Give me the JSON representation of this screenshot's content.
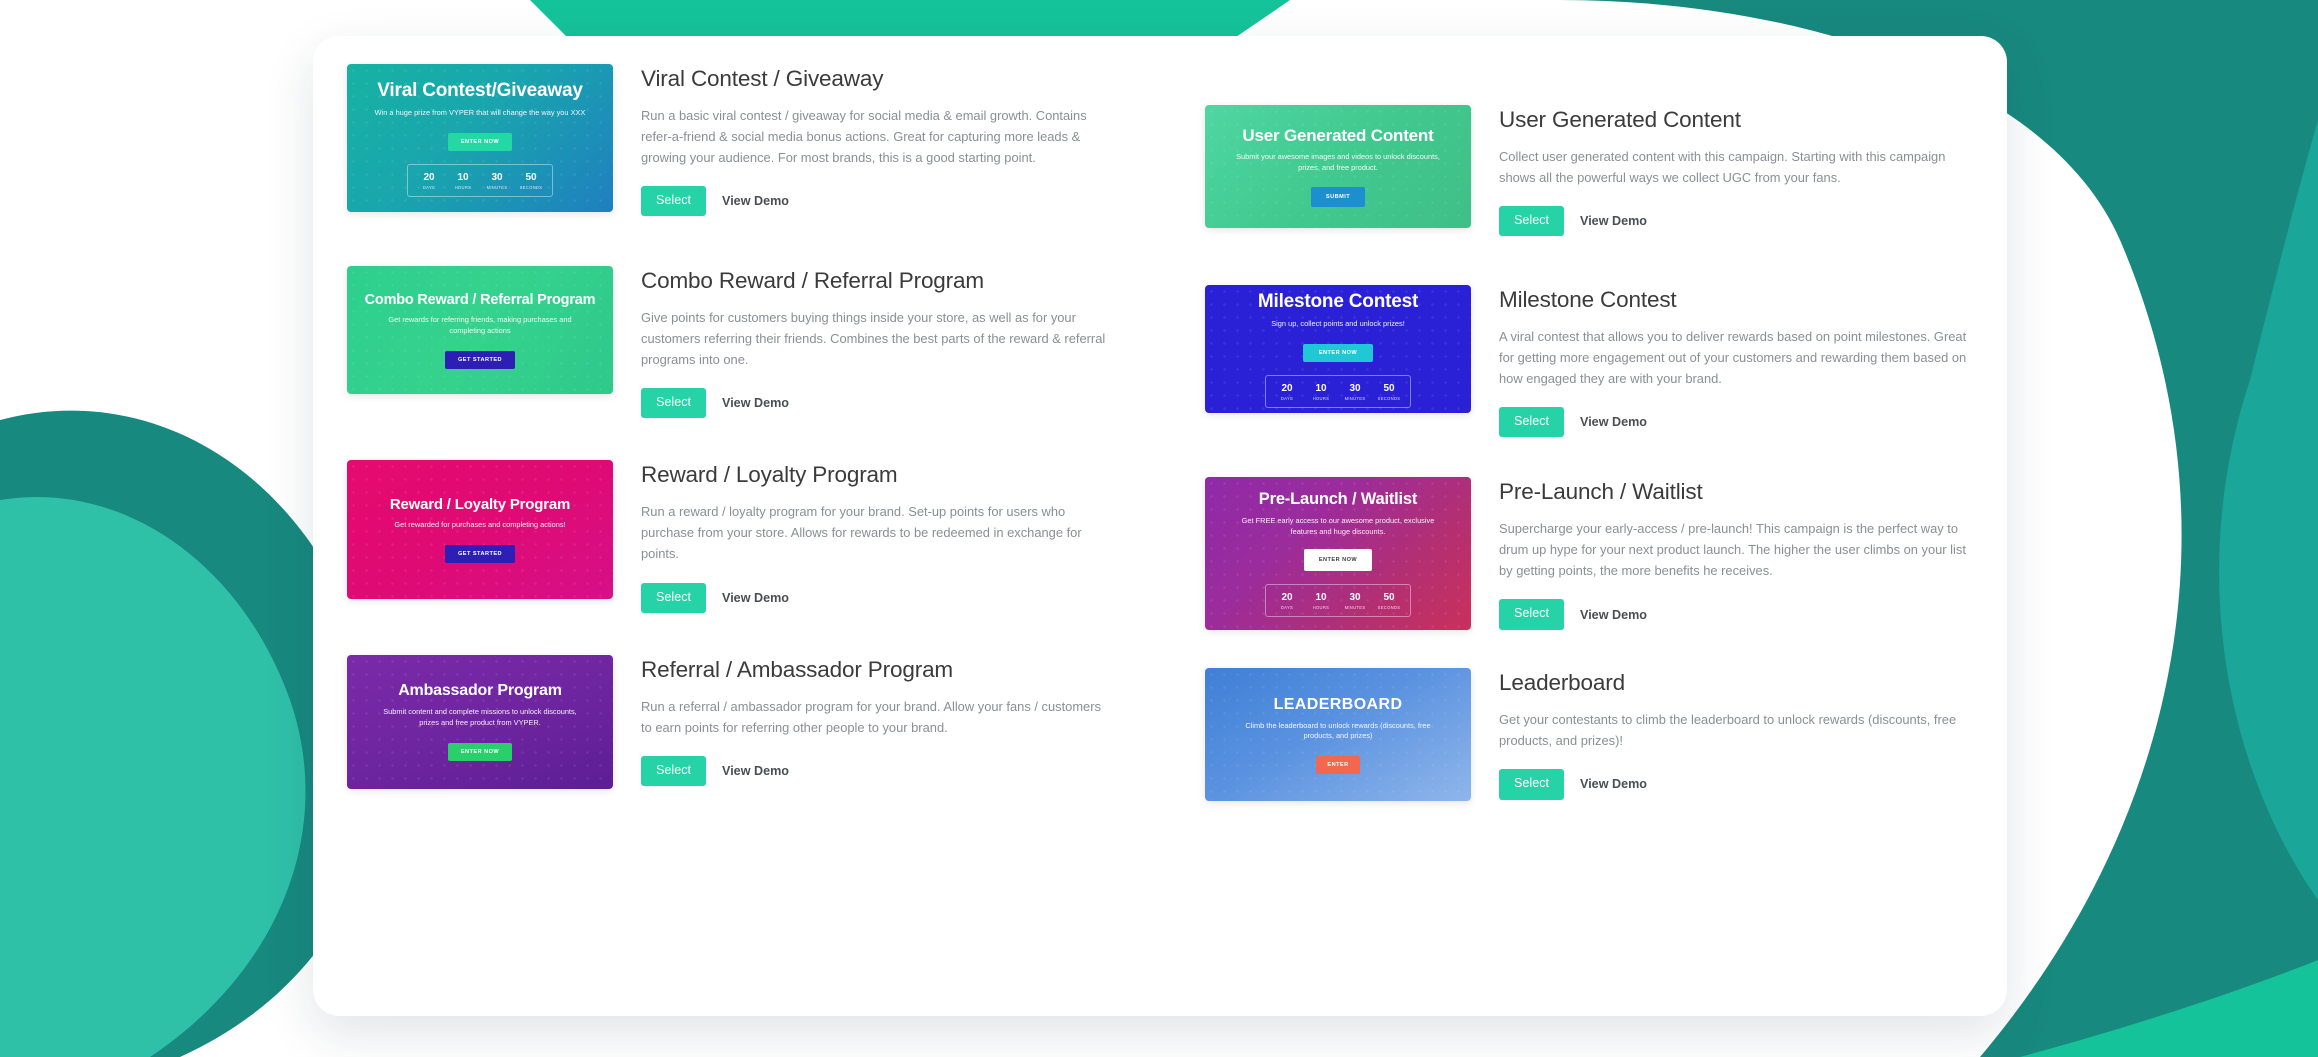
{
  "theme": {
    "accent": "#25d3a6",
    "panel_bg": "#ffffff",
    "teal_dark": "#18897f",
    "teal_mid": "#1aa79a",
    "teal_light": "#2fc0a8",
    "title_color": "#3b3b3b",
    "desc_color": "#8a8f96"
  },
  "actions": {
    "select_label": "Select",
    "view_demo_label": "View Demo"
  },
  "timer_labels": {
    "days": "DAYS",
    "hours": "HOURS",
    "minutes": "MINUTES",
    "seconds": "SECONDS"
  },
  "left": [
    {
      "thumb": {
        "title": "Viral Contest/Giveaway",
        "subtitle": "Win a huge prize from VYPER that will change the way you XXX",
        "button": "ENTER NOW",
        "timer": {
          "days": "20",
          "hours": "10",
          "minutes": "30",
          "seconds": "50"
        }
      },
      "title": "Viral Contest / Giveaway",
      "description": "Run a basic viral contest / giveaway for social media & email growth. Contains refer-a-friend & social media bonus actions. Great for capturing more leads & growing your audience. For most brands, this is a good starting point."
    },
    {
      "thumb": {
        "title": "Combo Reward / Referral Program",
        "subtitle": "Get rewards for referring friends, making purchases and completing actions",
        "button": "GET STARTED"
      },
      "title": "Combo Reward / Referral Program",
      "description": "Give points for customers buying things inside your store, as well as for your customers referring their friends. Combines the best parts of the reward & referral programs into one."
    },
    {
      "thumb": {
        "title": "Reward / Loyalty Program",
        "subtitle": "Get rewarded for purchases and completing actions!",
        "button": "GET STARTED"
      },
      "title": "Reward / Loyalty Program",
      "description": "Run a reward / loyalty program for your brand. Set-up points for users who purchase from your store. Allows for rewards to be redeemed in exchange for points."
    },
    {
      "thumb": {
        "title": "Ambassador Program",
        "subtitle": "Submit content and complete missions to unlock discounts, prizes and free product from VYPER.",
        "button": "ENTER NOW"
      },
      "title": "Referral / Ambassador Program",
      "description": "Run a referral / ambassador program for your brand. Allow your fans / customers to earn points for referring other people to your brand."
    }
  ],
  "right": [
    {
      "thumb": {
        "title": "User Generated Content",
        "subtitle": "Submit your awesome images and videos to unlock discounts, prizes, and free product.",
        "button": "SUBMIT"
      },
      "title": "User Generated Content",
      "description": "Collect user generated content with this campaign. Starting with this campaign shows all the powerful ways we collect UGC from your fans."
    },
    {
      "thumb": {
        "title": "Milestone Contest",
        "subtitle": "Sign up, collect points and unlock prizes!",
        "button": "ENTER NOW",
        "timer": {
          "days": "20",
          "hours": "10",
          "minutes": "30",
          "seconds": "50"
        }
      },
      "title": "Milestone Contest",
      "description": "A viral contest that allows you to deliver rewards based on point milestones. Great for getting more engagement out of your customers and rewarding them based on how engaged they are with your brand."
    },
    {
      "thumb": {
        "title": "Pre-Launch / Waitlist",
        "subtitle": "Get FREE early access to our awesome product, exclusive features and huge discounts.",
        "button": "ENTER NOW",
        "timer": {
          "days": "20",
          "hours": "10",
          "minutes": "30",
          "seconds": "50"
        }
      },
      "title": "Pre-Launch / Waitlist",
      "description": "Supercharge your early-access / pre-launch! This campaign is the perfect way to drum up hype for your next product launch. The higher the user climbs on your list by getting points, the more benefits he receives."
    },
    {
      "thumb": {
        "title": "LEADERBOARD",
        "subtitle": "Climb the leaderboard to unlock rewards (discounts, free products, and prizes)",
        "button": "ENTER"
      },
      "title": "Leaderboard",
      "description": "Get your contestants to climb the leaderboard to unlock rewards (discounts, free products, and prizes)!"
    }
  ]
}
